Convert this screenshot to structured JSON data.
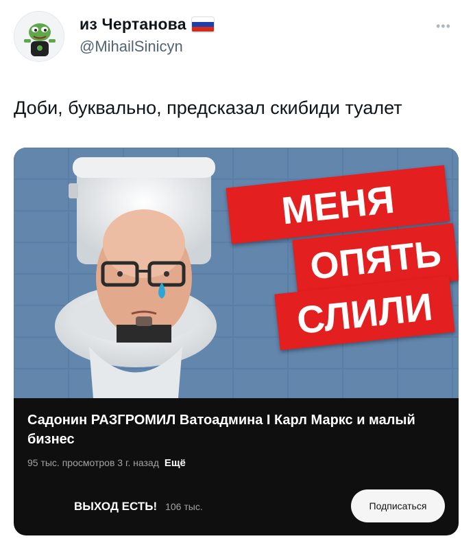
{
  "author": {
    "display_name": "из Чертанова",
    "handle": "@MihailSinicyn",
    "flag_icon": "russia-flag-icon",
    "flag_colors": [
      "#ffffff",
      "#1c3faa",
      "#d52b1e"
    ]
  },
  "more_icon": "more-horizontal-icon",
  "tweet_text": "Доби, буквально, предсказал скибиди туалет",
  "media": {
    "thumbnail_banners": [
      "МЕНЯ",
      "ОПЯТЬ",
      "СЛИЛИ"
    ],
    "video_title": "Садонин РАЗГРОМИЛ Ватоадмина I Карл Маркс и малый бизнес",
    "meta": "95 тыс. просмотров  3 г. назад",
    "more_label": "Ещё",
    "channel_name": "ВЫХОД ЕСТЬ!",
    "subscribers": "106 тыс.",
    "subscribe_label": "Подписаться",
    "accent_red": "#e41f1f",
    "tile_blue": "#5b7ea6"
  }
}
